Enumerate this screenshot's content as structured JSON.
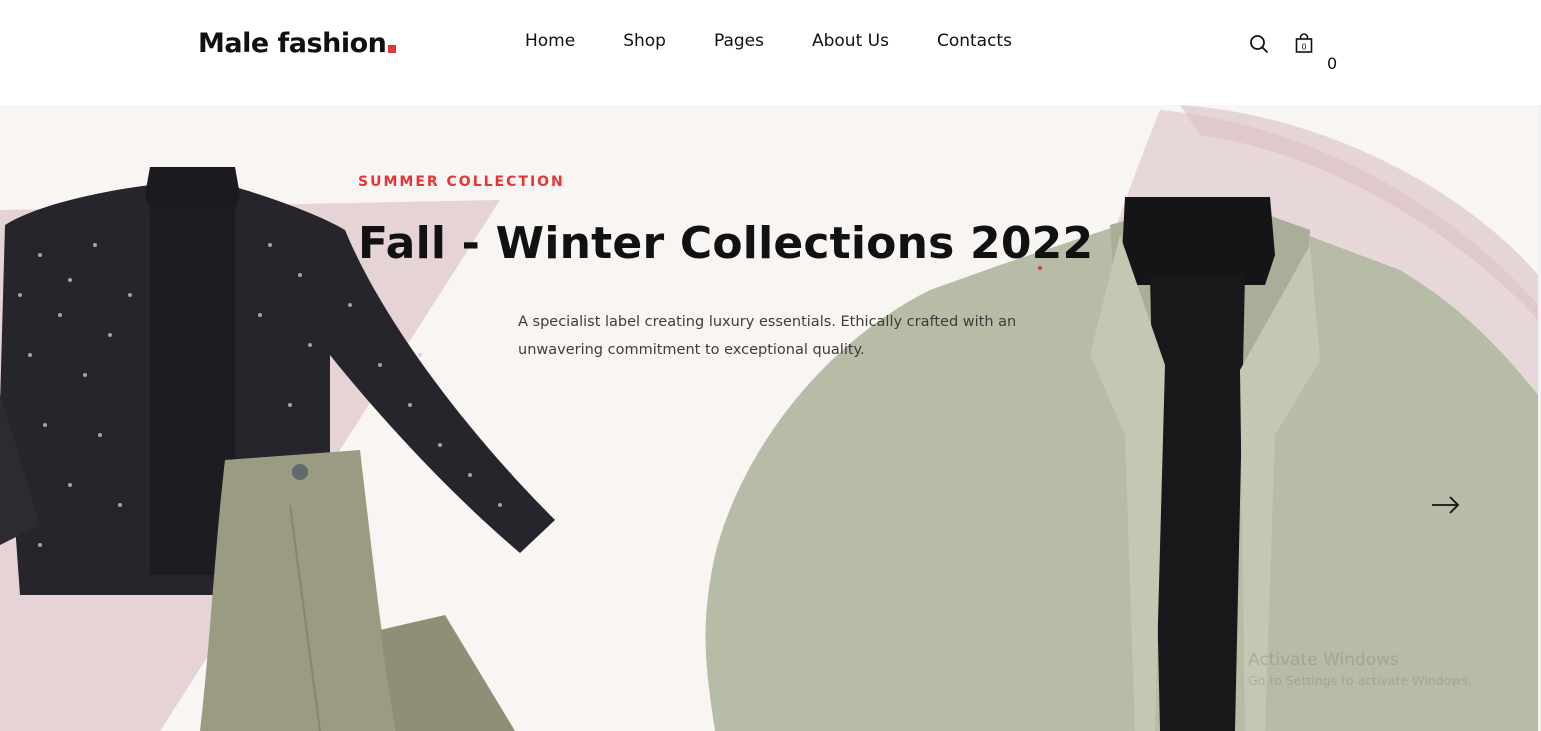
{
  "header": {
    "logo_text": "Male fashion",
    "nav": [
      {
        "label": "Home"
      },
      {
        "label": "Shop"
      },
      {
        "label": "Pages"
      },
      {
        "label": "About Us"
      },
      {
        "label": "Contacts"
      }
    ],
    "cart_count": "0",
    "icons": {
      "search": "search-icon",
      "cart": "shopping-bag-icon"
    },
    "accent_color": "#e53637"
  },
  "hero": {
    "eyebrow": "SUMMER COLLECTION",
    "headline": "Fall - Winter Collections 2022",
    "description": "A specialist label creating luxury essentials. Ethically crafted with an unwavering commitment to exceptional quality.",
    "next_icon": "arrow-right-icon",
    "background_color": "#f8f5f3"
  },
  "watermark": {
    "line1": "Activate Windows",
    "line2": "Go to Settings to activate Windows."
  }
}
